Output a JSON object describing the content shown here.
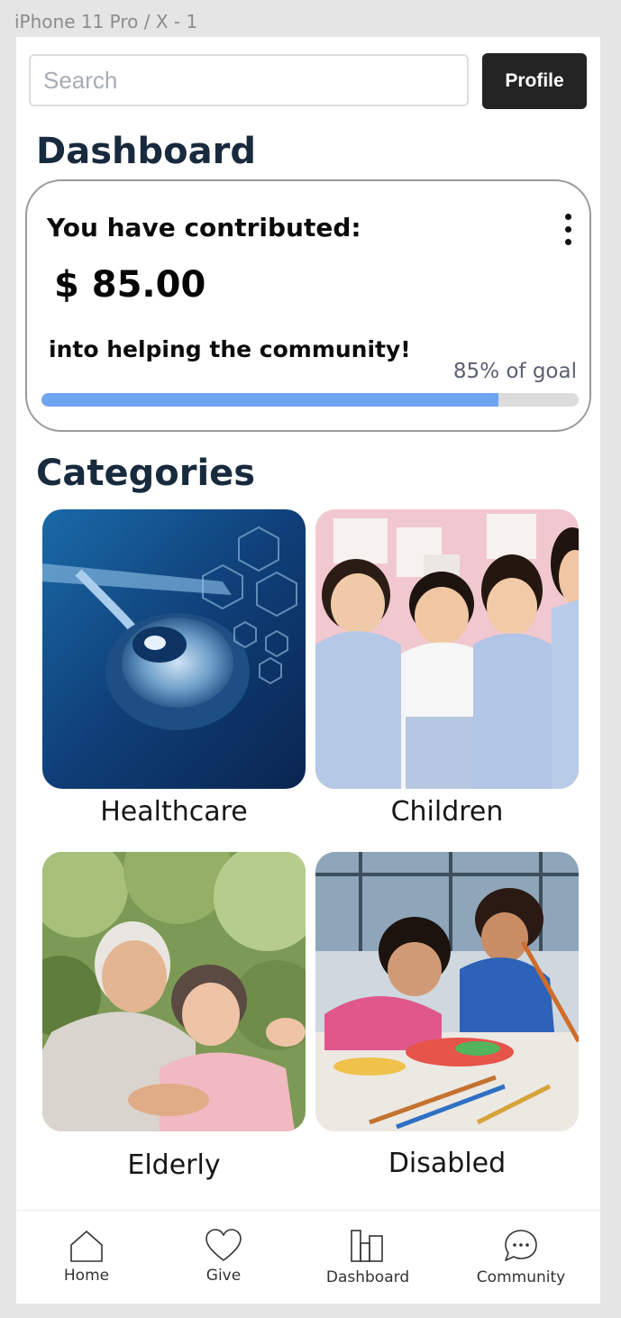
{
  "frame_label": "iPhone 11 Pro / X - 1",
  "search": {
    "placeholder": "Search"
  },
  "header": {
    "profile_label": "Profile"
  },
  "dashboard": {
    "title": "Dashboard",
    "contribution_title": "You have contributed:",
    "amount": "$ 85.00",
    "subtitle": "into helping the community!",
    "goal_text": "85% of goal",
    "progress": 0.85
  },
  "categories": {
    "title": "Categories",
    "items": [
      {
        "label": "Healthcare"
      },
      {
        "label": "Children"
      },
      {
        "label": "Elderly"
      },
      {
        "label": "Disabled"
      }
    ]
  },
  "nav": {
    "items": [
      {
        "label": "Home",
        "icon": "home-icon"
      },
      {
        "label": "Give",
        "icon": "heart-icon"
      },
      {
        "label": "Dashboard",
        "icon": "bar-chart-icon"
      },
      {
        "label": "Community",
        "icon": "chat-bubble-icon"
      }
    ]
  },
  "colors": {
    "accent": "#6fa4ef",
    "heading": "#182a3d",
    "button_dark": "#242424"
  }
}
